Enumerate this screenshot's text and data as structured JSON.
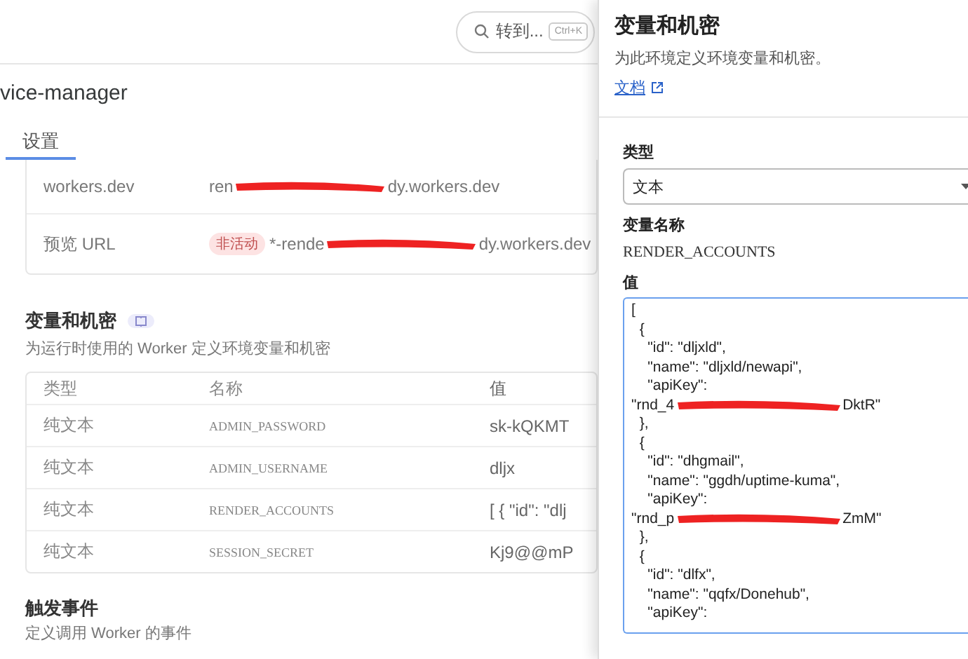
{
  "header": {
    "search": {
      "placeholder": "转到...",
      "shortcut": "Ctrl+K"
    },
    "title": "vice-manager",
    "tabs": [
      {
        "label": "设置",
        "selected": true
      }
    ]
  },
  "domains": {
    "rows": [
      {
        "label": "workers.dev",
        "value_start": "ren",
        "value_end": "dy.workers.dev"
      },
      {
        "label": "预览 URL",
        "badge": "非活动",
        "value_start": "*-rende",
        "value_end": "dy.workers.dev"
      }
    ]
  },
  "variables": {
    "title": "变量和机密",
    "subtitle": "为运行时使用的 Worker 定义环境变量和机密",
    "columns": [
      "类型",
      "名称",
      "值"
    ],
    "rows": [
      {
        "type": "纯文本",
        "name": "ADMIN_PASSWORD",
        "value": "sk-kQKMT"
      },
      {
        "type": "纯文本",
        "name": "ADMIN_USERNAME",
        "value": "dljx"
      },
      {
        "type": "纯文本",
        "name": "RENDER_ACCOUNTS",
        "value": "[ { \"id\": \"dlj"
      },
      {
        "type": "纯文本",
        "name": "SESSION_SECRET",
        "value": "Kj9@@mP"
      }
    ]
  },
  "triggers": {
    "title": "触发事件",
    "subtitle": "定义调用 Worker 的事件"
  },
  "drawer": {
    "title": "变量和机密",
    "subtitle": "为此环境定义环境变量和机密。",
    "docs_link": "文档",
    "type_label": "类型",
    "type_value": "文本",
    "name_label": "变量名称",
    "name_value": "RENDER_ACCOUNTS",
    "value_label": "值",
    "value_lines": [
      {
        "kind": "text",
        "text": "["
      },
      {
        "kind": "text",
        "text": "  {"
      },
      {
        "kind": "text",
        "text": "    \"id\": \"dljxld\","
      },
      {
        "kind": "text",
        "text": "    \"name\": \"dljxld/newapi\","
      },
      {
        "kind": "text",
        "text": "    \"apiKey\":"
      },
      {
        "kind": "redacted",
        "start": "\"rnd_4",
        "end": "DktR\""
      },
      {
        "kind": "text",
        "text": "  },"
      },
      {
        "kind": "text",
        "text": "  {"
      },
      {
        "kind": "text",
        "text": "    \"id\": \"dhgmail\","
      },
      {
        "kind": "text",
        "text": "    \"name\": \"ggdh/uptime-kuma\","
      },
      {
        "kind": "text",
        "text": "    \"apiKey\":"
      },
      {
        "kind": "redacted",
        "start": "\"rnd_p",
        "end": "ZmM\""
      },
      {
        "kind": "text",
        "text": "  },"
      },
      {
        "kind": "text",
        "text": "  {"
      },
      {
        "kind": "text",
        "text": "    \"id\": \"dlfx\","
      },
      {
        "kind": "text",
        "text": "    \"name\": \"qqfx/Donehub\","
      },
      {
        "kind": "text",
        "text": "    \"apiKey\":"
      }
    ]
  }
}
